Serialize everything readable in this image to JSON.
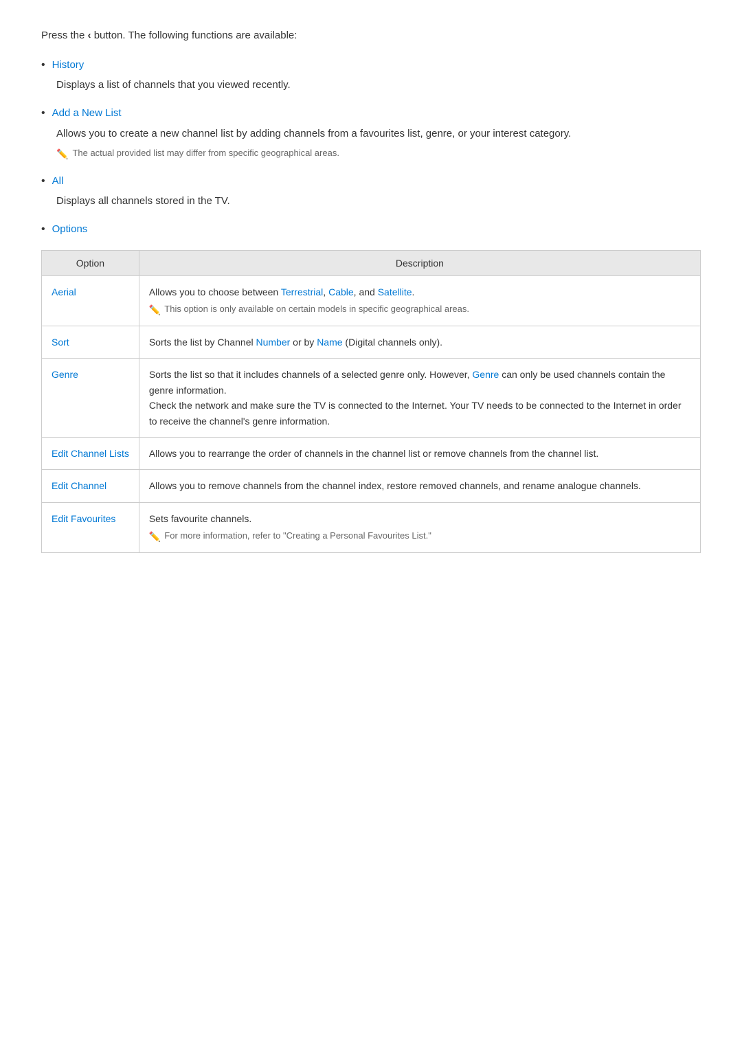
{
  "intro": {
    "text": "Press the ",
    "button_label": "<",
    "text_after": " button. The following functions are available:"
  },
  "bullet_items": [
    {
      "id": "history",
      "label": "History",
      "description": "Displays a list of channels that you viewed recently."
    },
    {
      "id": "add-new-list",
      "label": "Add a New List",
      "description": "Allows you to create a new channel list by adding channels from a favourites list, genre, or your interest category.",
      "note": "The actual provided list may differ from specific geographical areas."
    },
    {
      "id": "all",
      "label": "All",
      "description": "Displays all channels stored in the TV."
    },
    {
      "id": "options",
      "label": "Options"
    }
  ],
  "table": {
    "col_option": "Option",
    "col_description": "Description",
    "rows": [
      {
        "option": "Aerial",
        "description": "Allows you to choose between Terrestrial, Cable, and Satellite.",
        "note": "This option is only available on certain models in specific geographical areas.",
        "links": [
          "Terrestrial",
          "Cable",
          "Satellite"
        ]
      },
      {
        "option": "Sort",
        "description": "Sorts the list by Channel Number or by Name (Digital channels only).",
        "links": [
          "Number",
          "Name"
        ]
      },
      {
        "option": "Genre",
        "description": "Sorts the list so that it includes channels of a selected genre only. However, Genre can only be used channels contain the genre information.\nCheck the network and make sure the TV is connected to the Internet. Your TV needs to be connected to the Internet in order to receive the channel's genre information.",
        "links": [
          "Genre"
        ]
      },
      {
        "option": "Edit Channel Lists",
        "description": "Allows you to rearrange the order of channels in the channel list or remove channels from the channel list."
      },
      {
        "option": "Edit Channel",
        "description": "Allows you to remove channels from the channel index, restore removed channels, and rename analogue channels."
      },
      {
        "option": "Edit Favourites",
        "description": "Sets favourite channels.",
        "note": "For more information, refer to \"Creating a Personal Favourites List.\""
      }
    ]
  }
}
